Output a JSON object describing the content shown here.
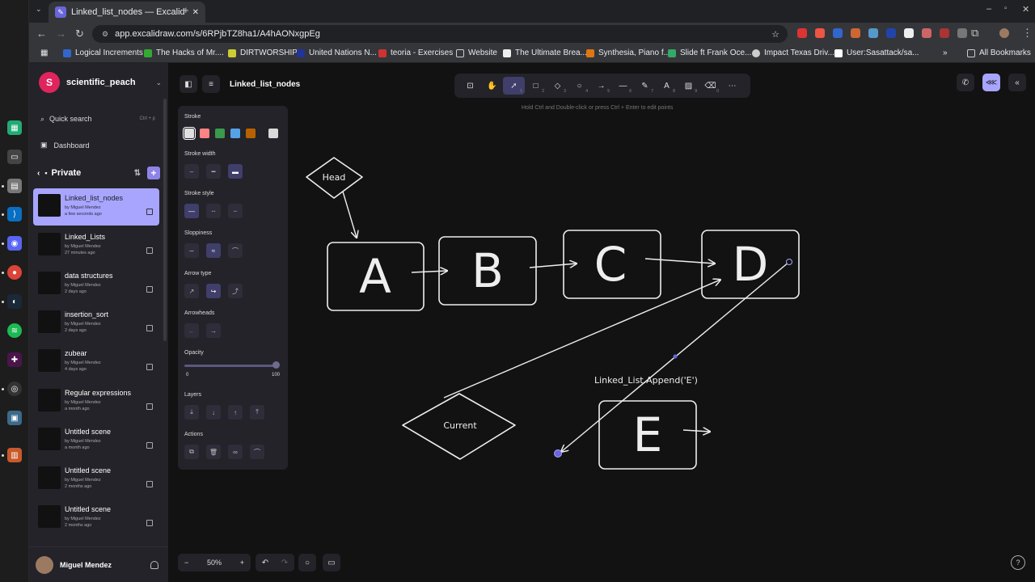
{
  "browser": {
    "tab_title": "Linked_list_nodes — Excalid",
    "url": "app.excalidraw.com/s/6RPjbTZ8ha1/A4hAONxgpEg",
    "new_tab": "+",
    "bookmarks": [
      "Logical Increments",
      "The Hacks of Mr....",
      "DIRTWORSHIP",
      "United Nations N...",
      "teoria - Exercises",
      "Website",
      "The Ultimate Brea...",
      "Synthesia, Piano f...",
      "Slide ft Frank Oce...",
      "Impact Texas Driv...",
      "User:Sasattack/sa..."
    ],
    "bookmarks_overflow": "»",
    "all_bookmarks": "All Bookmarks"
  },
  "sidebar": {
    "workspace_initial": "S",
    "workspace_name": "scientific_peach",
    "quick_search": "Quick search",
    "quick_search_kbd": "Ctrl + p",
    "dashboard": "Dashboard",
    "private_label": "Private",
    "scenes": [
      {
        "name": "Linked_list_nodes",
        "by": "by Miguel Mendez",
        "time": "a few seconds ago"
      },
      {
        "name": "Linked_Lists",
        "by": "by Miguel Mendez",
        "time": "27 minutes ago"
      },
      {
        "name": "data structures",
        "by": "by Miguel Mendez",
        "time": "2 days ago"
      },
      {
        "name": "insertion_sort",
        "by": "by Miguel Mendez",
        "time": "2 days ago"
      },
      {
        "name": "zubear",
        "by": "by Miguel Mendez",
        "time": "4 days ago"
      },
      {
        "name": "Regular expressions",
        "by": "by Miguel Mendez",
        "time": "a month ago"
      },
      {
        "name": "Untitled scene",
        "by": "by Miguel Mendez",
        "time": "a month ago"
      },
      {
        "name": "Untitled scene",
        "by": "by Miguel Mendez",
        "time": "2 months ago"
      },
      {
        "name": "Untitled scene",
        "by": "by Miguel Mendez",
        "time": "2 months ago"
      }
    ],
    "user_name": "Miguel Mendez"
  },
  "canvas": {
    "doc_title": "Linked_list_nodes",
    "hint": "Hold Ctrl and Double-click or press Ctrl + Enter to edit points",
    "tool_keys": [
      "",
      "",
      "1",
      "2",
      "3",
      "4",
      "5",
      "6",
      "7",
      "8",
      "9",
      "0",
      ""
    ],
    "zoom": "50%",
    "minus": "−",
    "plus": "+",
    "help": "?"
  },
  "properties": {
    "stroke": "Stroke",
    "stroke_width": "Stroke width",
    "stroke_style": "Stroke style",
    "sloppiness": "Sloppiness",
    "arrow_type": "Arrow type",
    "arrowheads": "Arrowheads",
    "opacity": "Opacity",
    "opacity_min": "0",
    "opacity_max": "100",
    "layers": "Layers",
    "actions": "Actions",
    "stroke_colors": [
      "#e0e0e0",
      "#ff8383",
      "#3a994c",
      "#56a2e8",
      "#b76100",
      "#d9d9d9"
    ]
  },
  "drawing": {
    "head": "Head",
    "nodes": [
      "A",
      "B",
      "C",
      "D",
      "E"
    ],
    "current": "Current",
    "append_text": "Linked_List.Append('E')"
  }
}
